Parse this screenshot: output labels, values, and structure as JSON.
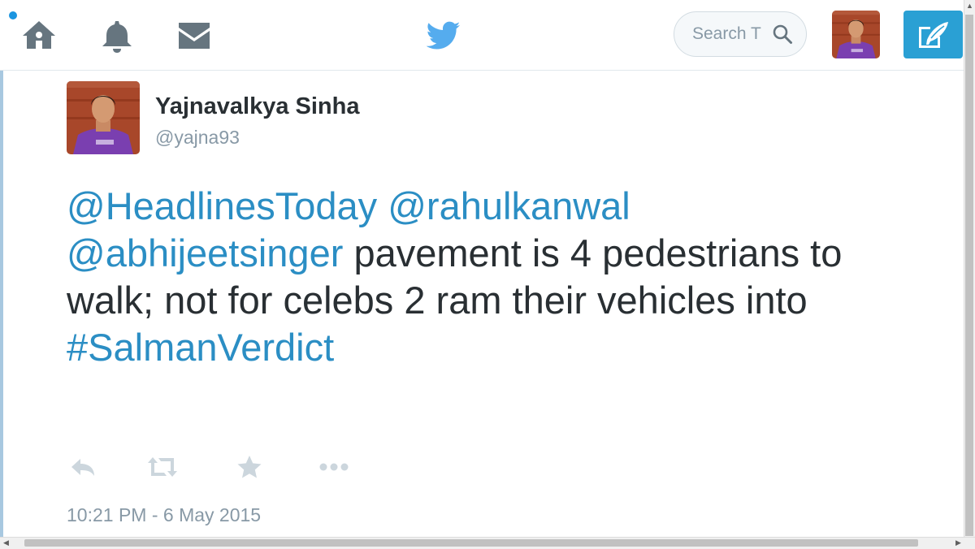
{
  "nav": {
    "home_icon": "home-icon",
    "notifications_icon": "bell-icon",
    "messages_icon": "mail-icon",
    "logo_icon": "twitter-bird-icon",
    "search": {
      "placeholder": "Search T",
      "icon": "search-icon"
    },
    "compose_icon": "compose-tweet-icon"
  },
  "tweet": {
    "author": {
      "name": "Yajnavalkya Sinha",
      "handle": "@yajna93"
    },
    "text_parts": {
      "mention1": "@HeadlinesToday",
      "mention2": "@rahulkanwal",
      "mention3": "@abhijeetsinger",
      "body": "pavement is 4 pedestrians to walk; not for celebs 2 ram their vehicles into",
      "hashtag": "#SalmanVerdict"
    },
    "actions": [
      "reply-icon",
      "retweet-icon",
      "favorite-icon",
      "more-icon"
    ],
    "timestamp": "10:21 PM - 6 May 2015"
  },
  "colors": {
    "link": "#2b8ec4",
    "text": "#292f33",
    "muted": "#8899a6",
    "accent": "#2aa0d4",
    "nav_icon": "#66757f",
    "action_icon": "#ccd6dd"
  }
}
